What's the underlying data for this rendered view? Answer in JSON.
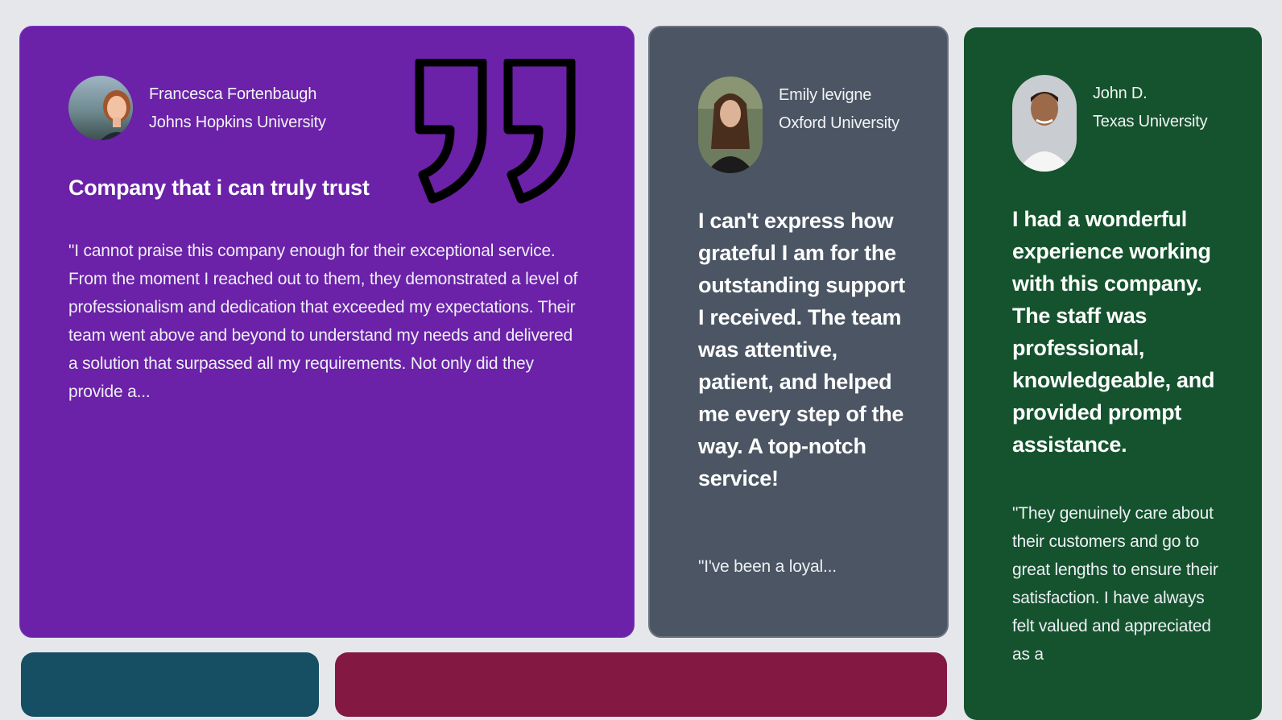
{
  "testimonials": [
    {
      "name": "Francesca Fortenbaugh",
      "school": "Johns Hopkins University",
      "headline": "Company that i can truly trust",
      "body": "\"I cannot praise this company enough for their exceptional service. From the moment I reached out to them, they demonstrated a level of professionalism and dedication that exceeded my expectations. Their team went above and beyond to understand my needs and delivered a solution that surpassed all my requirements. Not only did they provide a...",
      "color": "#6b21a8"
    },
    {
      "name": "Emily levigne",
      "school": "Oxford University",
      "headline": "I can't express how grateful I am for the outstanding support I received. The team was attentive, patient, and helped me every step of the way. A top-notch service!",
      "body": "\"I've been a loyal...",
      "color": "#4b5563"
    },
    {
      "name": "John D.",
      "school": "Texas University",
      "headline": "I had a wonderful experience working with this company. The staff was professional, knowledgeable, and provided prompt assistance.",
      "body": "\"They genuinely care about their customers and go to great lengths to ensure their satisfaction. I have always felt valued and appreciated as a",
      "color": "#14532d"
    }
  ],
  "partial_cards": [
    {
      "color": "#164e63"
    },
    {
      "color": "#831843"
    }
  ],
  "icons": {
    "quote": "quote-icon",
    "avatar": "avatar"
  }
}
